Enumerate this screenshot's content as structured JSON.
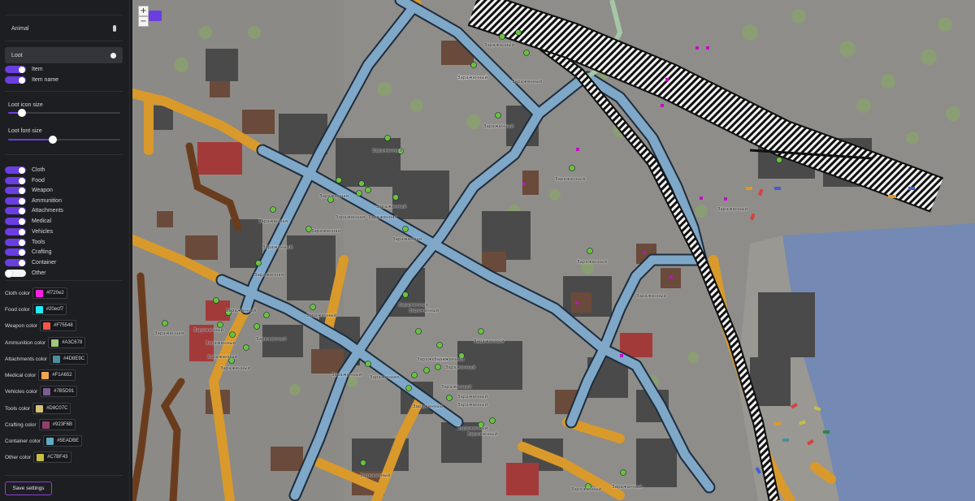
{
  "sidebar": {
    "dropdowns": [
      {
        "label": "Animal"
      },
      {
        "label": "Loot"
      }
    ],
    "loot_toggles": [
      {
        "label": "Item",
        "on": true
      },
      {
        "label": "Item name",
        "on": true
      }
    ],
    "sliders": [
      {
        "label": "Loot icon size",
        "value": 0.12
      },
      {
        "label": "Loot font size",
        "value": 0.4
      }
    ],
    "category_toggles": [
      {
        "label": "Cloth",
        "on": true
      },
      {
        "label": "Food",
        "on": true
      },
      {
        "label": "Weapon",
        "on": true
      },
      {
        "label": "Ammunition",
        "on": true
      },
      {
        "label": "Attachments",
        "on": true
      },
      {
        "label": "Medical",
        "on": true
      },
      {
        "label": "Vehicles",
        "on": true
      },
      {
        "label": "Tools",
        "on": true
      },
      {
        "label": "Crafting",
        "on": true
      },
      {
        "label": "Container",
        "on": true
      },
      {
        "label": "Other",
        "on": false
      }
    ],
    "colors": [
      {
        "label": "Cloth color",
        "value": "#f720e2",
        "swatch": "#f720e2"
      },
      {
        "label": "Food color",
        "value": "#20ecf7",
        "swatch": "#20ecf7"
      },
      {
        "label": "Weapon color",
        "value": "#F75548",
        "swatch": "#F75548"
      },
      {
        "label": "Ammunition color",
        "value": "#A3C678",
        "swatch": "#A3C678"
      },
      {
        "label": "Attachments color",
        "value": "#4D8E9C",
        "swatch": "#4D8E9C"
      },
      {
        "label": "Medical color",
        "value": "#F1A652",
        "swatch": "#F1A652"
      },
      {
        "label": "Vehicles color",
        "value": "#7B5D91",
        "swatch": "#7B5D91"
      },
      {
        "label": "Tools color",
        "value": "#D8C07C",
        "swatch": "#D8C07C"
      },
      {
        "label": "Crafting color",
        "value": "#923F6B",
        "swatch": "#923F6B"
      },
      {
        "label": "Container color",
        "value": "#5EADBE",
        "swatch": "#5EADBE"
      },
      {
        "label": "Other color",
        "value": "#C7BF43",
        "swatch": "#C7BF43"
      }
    ],
    "save_label": "Save settings"
  },
  "map": {
    "zoom_in": "+",
    "zoom_out": "−",
    "labels": [
      {
        "text": "Зараженный",
        "cls": "g"
      },
      {
        "text": "Зараженный",
        "cls": "g"
      },
      {
        "text": "Зараженный",
        "cls": "g"
      },
      {
        "text": "Зараженный",
        "cls": "g"
      },
      {
        "text": "Зараженный",
        "cls": "g"
      },
      {
        "text": "Зараженный",
        "cls": "g"
      },
      {
        "text": "Зараженный",
        "cls": "g"
      },
      {
        "text": "Зараженный",
        "cls": "g"
      },
      {
        "text": "Зараженная",
        "cls": "g"
      },
      {
        "text": "Зараженная",
        "cls": "g"
      },
      {
        "text": "Зараженная",
        "cls": "g"
      },
      {
        "text": "Зараженная",
        "cls": "g"
      },
      {
        "text": "Зараженная",
        "cls": "g"
      },
      {
        "text": "Зараженная",
        "cls": "g"
      },
      {
        "text": "Зараженная",
        "cls": "g"
      },
      {
        "text": "Зараженный",
        "cls": "g"
      },
      {
        "text": "Зараженный",
        "cls": "g"
      },
      {
        "text": "Зараженный",
        "cls": "g"
      },
      {
        "text": "Зараженный",
        "cls": "g"
      },
      {
        "text": "Зараженный",
        "cls": "g"
      },
      {
        "text": "Зараженный",
        "cls": "g"
      },
      {
        "text": "Зараженный",
        "cls": "g"
      },
      {
        "text": "Зараженная",
        "cls": "g"
      },
      {
        "text": "Зараженный",
        "cls": "g"
      },
      {
        "text": "Зараженный",
        "cls": "g"
      },
      {
        "text": "Зараженный",
        "cls": "g"
      },
      {
        "text": "Зараженный",
        "cls": "g"
      },
      {
        "text": "Зараженный",
        "cls": "g"
      },
      {
        "text": "Зараженный",
        "cls": "g"
      },
      {
        "text": "Зараженный",
        "cls": "g"
      },
      {
        "text": "Зараженный",
        "cls": "g"
      },
      {
        "text": "Зараженный",
        "cls": "g"
      },
      {
        "text": "Зараженный",
        "cls": "g"
      },
      {
        "text": "Зараженный",
        "cls": "g"
      },
      {
        "text": "Зараженная",
        "cls": "g"
      },
      {
        "text": "Зараженный",
        "cls": "g"
      },
      {
        "text": "Зараженный",
        "cls": "g"
      },
      {
        "text": "Зараженный",
        "cls": "g"
      },
      {
        "text": "Зараженный",
        "cls": "g"
      },
      {
        "text": "Зараженный",
        "cls": "g"
      },
      {
        "text": "Зараженный",
        "cls": "g"
      },
      {
        "text": "Зараженный",
        "cls": "g"
      },
      {
        "text": "Зараженный",
        "cls": "g"
      },
      {
        "text": "Зараженный",
        "cls": "g"
      }
    ]
  }
}
